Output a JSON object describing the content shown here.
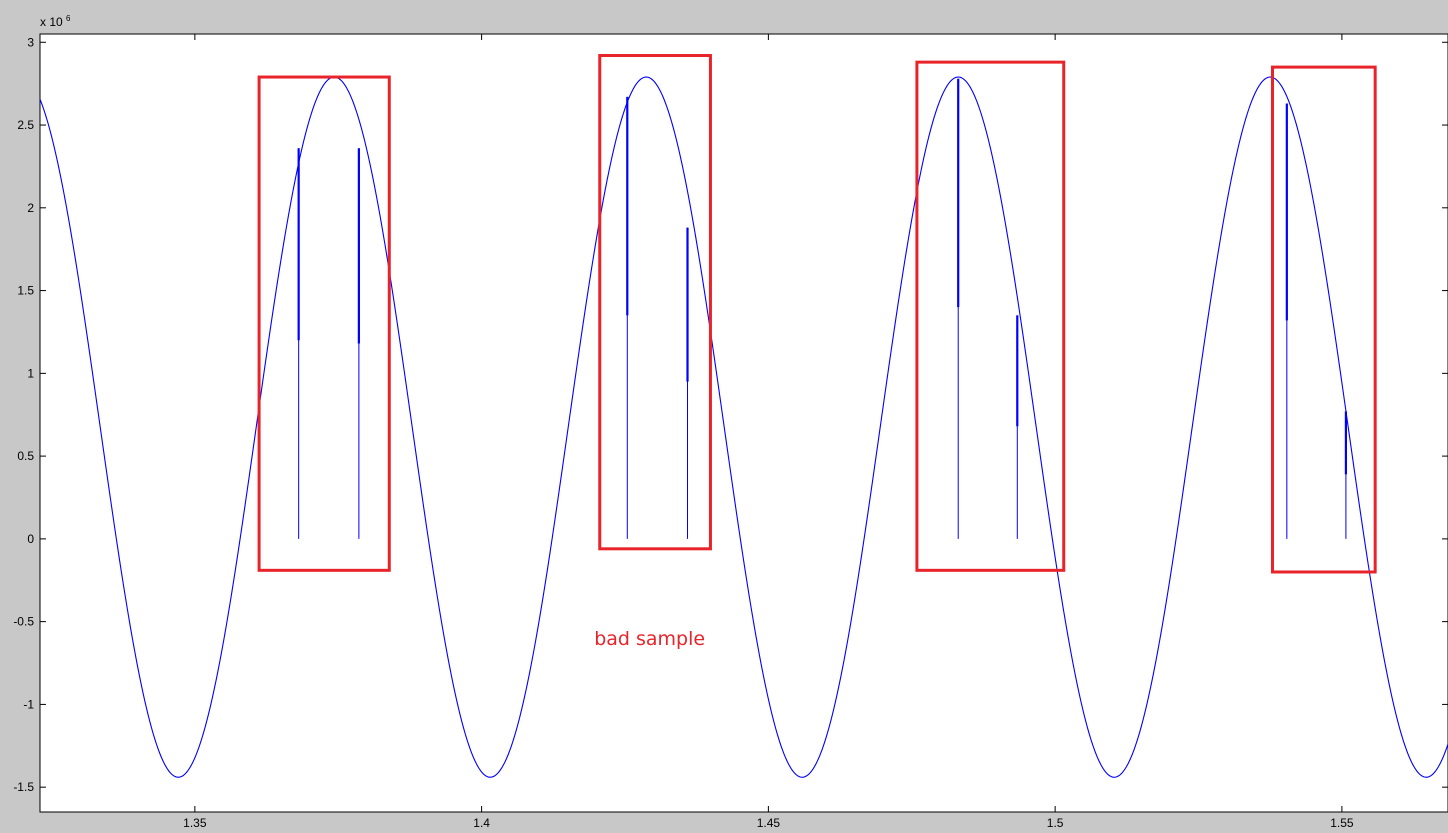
{
  "chart_data": {
    "type": "line",
    "title": "",
    "xlabel": "",
    "ylabel": "",
    "y_exponent": "x 10",
    "y_exponent_power": "6",
    "xlim": [
      1.323,
      1.5685
    ],
    "ylim": [
      -1.65,
      3.05
    ],
    "x_ticks": [
      {
        "value": 1.35,
        "label": "1.35"
      },
      {
        "value": 1.4,
        "label": "1.4"
      },
      {
        "value": 1.45,
        "label": "1.45"
      },
      {
        "value": 1.5,
        "label": "1.5"
      },
      {
        "value": 1.55,
        "label": "1.55"
      }
    ],
    "y_ticks": [
      {
        "value": 3,
        "label": "3"
      },
      {
        "value": 2.5,
        "label": "2.5"
      },
      {
        "value": 2,
        "label": "2"
      },
      {
        "value": 1.5,
        "label": "1.5"
      },
      {
        "value": 1,
        "label": "1"
      },
      {
        "value": 0.5,
        "label": "0.5"
      },
      {
        "value": 0,
        "label": "0"
      },
      {
        "value": -0.5,
        "label": "-0.5"
      },
      {
        "value": -1,
        "label": "-1"
      },
      {
        "value": -1.5,
        "label": "-1.5"
      }
    ],
    "grid": false,
    "signal": {
      "shape": "sine",
      "period": 0.0544,
      "peak_x": 1.3743,
      "peak_y": 2.79,
      "trough_y": -1.44,
      "color": "#0000ff"
    },
    "spikes": [
      {
        "x": 1.3681,
        "y_top": 2.36,
        "y_solid": 1.2,
        "y_bottom": 0
      },
      {
        "x": 1.3786,
        "y_top": 2.36,
        "y_solid": 1.18,
        "y_bottom": 0
      },
      {
        "x": 1.4254,
        "y_top": 2.67,
        "y_solid": 1.35,
        "y_bottom": 0
      },
      {
        "x": 1.4359,
        "y_top": 1.88,
        "y_solid": 0.95,
        "y_bottom": 0
      },
      {
        "x": 1.4831,
        "y_top": 2.78,
        "y_solid": 1.4,
        "y_bottom": 0
      },
      {
        "x": 1.4934,
        "y_top": 1.35,
        "y_solid": 0.68,
        "y_bottom": 0
      },
      {
        "x": 1.5404,
        "y_top": 2.63,
        "y_solid": 1.32,
        "y_bottom": 0
      },
      {
        "x": 1.5507,
        "y_top": 0.77,
        "y_solid": 0.39,
        "y_bottom": 0
      }
    ],
    "boxes": [
      {
        "x0": 1.3612,
        "x1": 1.3839,
        "y0": -0.19,
        "y1": 2.79
      },
      {
        "x0": 1.4206,
        "x1": 1.4399,
        "y0": -0.06,
        "y1": 2.92
      },
      {
        "x0": 1.4759,
        "x1": 1.5015,
        "y0": -0.19,
        "y1": 2.88
      },
      {
        "x0": 1.5379,
        "x1": 1.5558,
        "y0": -0.2,
        "y1": 2.85
      }
    ],
    "box_color": "#e8242a",
    "annotation": {
      "text": "bad sample",
      "x": 1.4293,
      "y": -0.6
    }
  }
}
